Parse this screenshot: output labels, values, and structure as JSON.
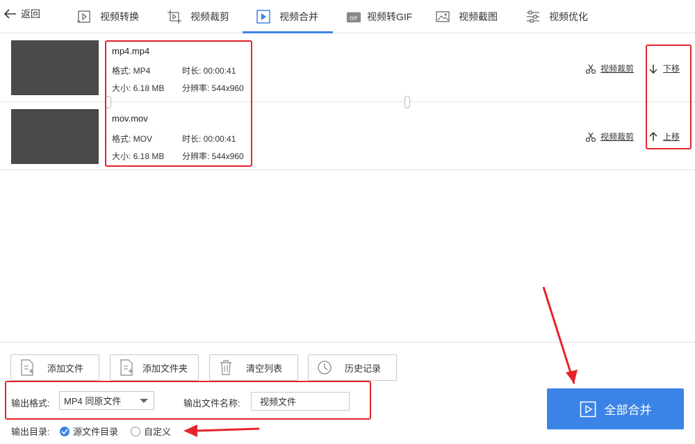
{
  "nav": {
    "back_label": "返回",
    "tabs": [
      {
        "label": "视频转换",
        "icon": "video-convert-icon"
      },
      {
        "label": "视频裁剪",
        "icon": "video-crop-icon"
      },
      {
        "label": "视频合并",
        "icon": "video-merge-icon",
        "active": true
      },
      {
        "label": "视频转GIF",
        "icon": "gif-icon"
      },
      {
        "label": "视频截图",
        "icon": "image-icon"
      },
      {
        "label": "视频优化",
        "icon": "sliders-icon"
      }
    ]
  },
  "files": [
    {
      "name": "mp4.mp4",
      "format_label": "格式: MP4",
      "duration_label": "时长: 00:00:41",
      "size_label": "大小: 6.18 MB",
      "resolution_label": "分辨率: 544x960",
      "crop_label": "视频裁剪",
      "move_label": "下移",
      "move_icon": "arrow-down-icon"
    },
    {
      "name": "mov.mov",
      "format_label": "格式: MOV",
      "duration_label": "时长: 00:00:41",
      "size_label": "大小: 6.18 MB",
      "resolution_label": "分辨率: 544x960",
      "crop_label": "视频裁剪",
      "move_label": "上移",
      "move_icon": "arrow-up-icon"
    }
  ],
  "toolbar": {
    "add_file": "添加文件",
    "add_folder": "添加文件夹",
    "clear_list": "清空列表",
    "history": "历史记录"
  },
  "output": {
    "format_label": "输出格式:",
    "format_value": "MP4 同原文件",
    "filename_label": "输出文件名称:",
    "filename_value": "视频文件",
    "dir_label": "输出目录:",
    "dir_options": [
      {
        "label": "源文件目录",
        "checked": true
      },
      {
        "label": "自定义",
        "checked": false
      }
    ]
  },
  "merge_button": "全部合并",
  "colors": {
    "accent": "#3b83e6",
    "annotation": "#e4242a",
    "thumbnail": "#4a4a4a"
  }
}
